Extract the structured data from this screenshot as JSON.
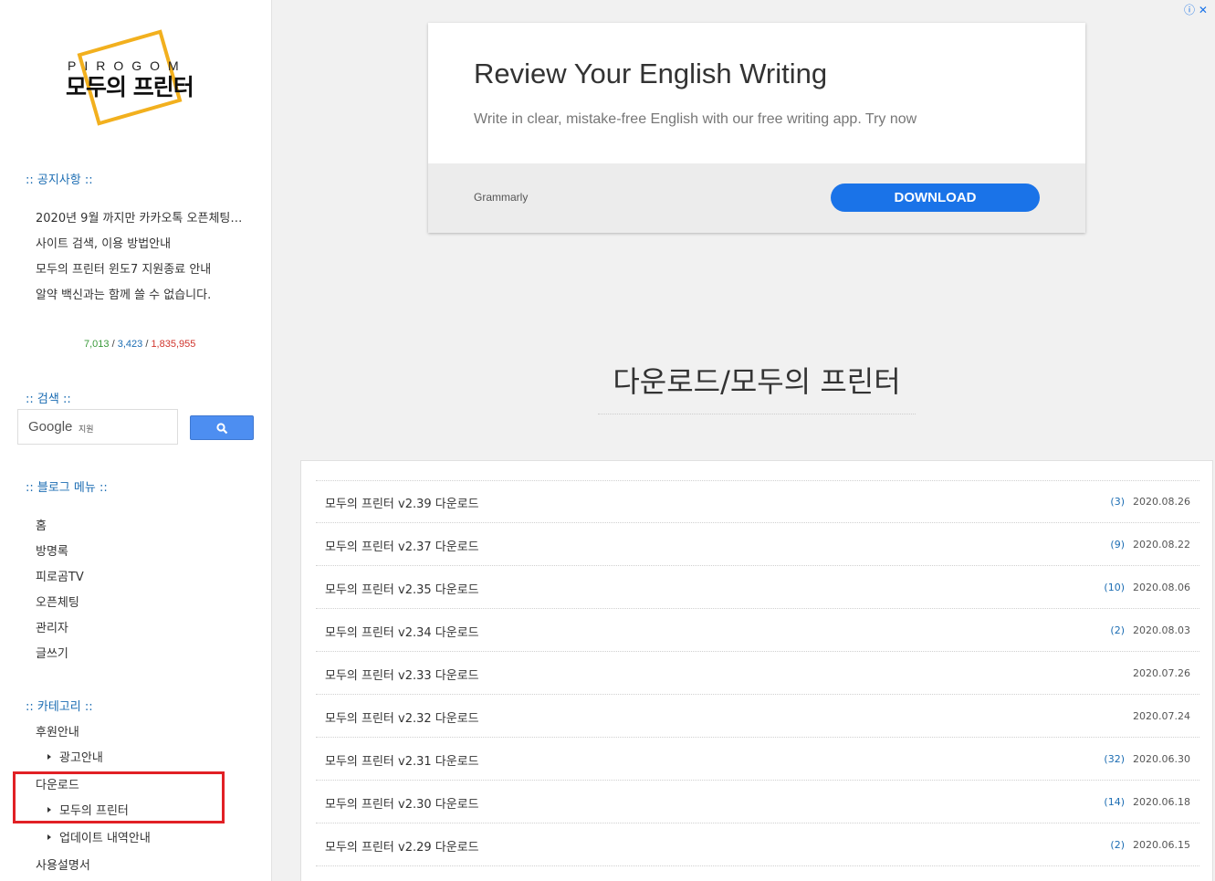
{
  "logo": {
    "top_text": "PIROGOM",
    "main_text": "모두의 프린터"
  },
  "notice": {
    "title": ":: 공지사항 ::",
    "items": [
      "2020년 9월 까지만 카카오톡 오픈체팅…",
      "사이트 검색, 이용 방법안내",
      "모두의 프린터 윈도7 지원종료 안내",
      "알약 백신과는 함께 쓸 수 없습니다."
    ]
  },
  "counter": {
    "today": "7,013",
    "yesterday": "3,423",
    "total": "1,835,955",
    "separator": "/"
  },
  "search": {
    "title": ":: 검색 ::",
    "google_label": "Google",
    "sub_label": "지원",
    "button_icon": "search-icon"
  },
  "blog_menu": {
    "title": ":: 블로그 메뉴 ::",
    "items": [
      "홈",
      "방명록",
      "피로곰TV",
      "오픈체팅",
      "관리자",
      "글쓰기"
    ]
  },
  "category": {
    "title": ":: 카테고리 ::",
    "items": [
      {
        "label": "후원안내",
        "level": 0
      },
      {
        "label": "광고안내",
        "level": 1
      },
      {
        "label": "다운로드",
        "level": 0
      },
      {
        "label": "모두의 프린터",
        "level": 1
      },
      {
        "label": "업데이트 내역안내",
        "level": 1
      },
      {
        "label": "사용설명서",
        "level": 0
      }
    ]
  },
  "ad": {
    "info_icons": "ⓘ ✕",
    "title": "Review Your English Writing",
    "description": "Write in clear, mistake-free English with our free writing app. Try now",
    "brand": "Grammarly",
    "button": "DOWNLOAD"
  },
  "main": {
    "page_title": "다운로드/모두의 프린터",
    "posts": [
      {
        "title": "모두의 프린터 v2.39 다운로드",
        "count": "(3)",
        "date": "2020.08.26"
      },
      {
        "title": "모두의 프린터 v2.37 다운로드",
        "count": "(9)",
        "date": "2020.08.22"
      },
      {
        "title": "모두의 프린터 v2.35 다운로드",
        "count": "(10)",
        "date": "2020.08.06"
      },
      {
        "title": "모두의 프린터 v2.34 다운로드",
        "count": "(2)",
        "date": "2020.08.03"
      },
      {
        "title": "모두의 프린터 v2.33 다운로드",
        "count": "",
        "date": "2020.07.26"
      },
      {
        "title": "모두의 프린터 v2.32 다운로드",
        "count": "",
        "date": "2020.07.24"
      },
      {
        "title": "모두의 프린터 v2.31 다운로드",
        "count": "(32)",
        "date": "2020.06.30"
      },
      {
        "title": "모두의 프린터 v2.30 다운로드",
        "count": "(14)",
        "date": "2020.06.18"
      },
      {
        "title": "모두의 프린터 v2.29 다운로드",
        "count": "(2)",
        "date": "2020.06.15"
      }
    ]
  },
  "colors": {
    "accent_blue": "#1c6db3",
    "logo_yellow": "#f2b01e",
    "highlight_red": "#e12025",
    "ad_button": "#1a73e8"
  }
}
